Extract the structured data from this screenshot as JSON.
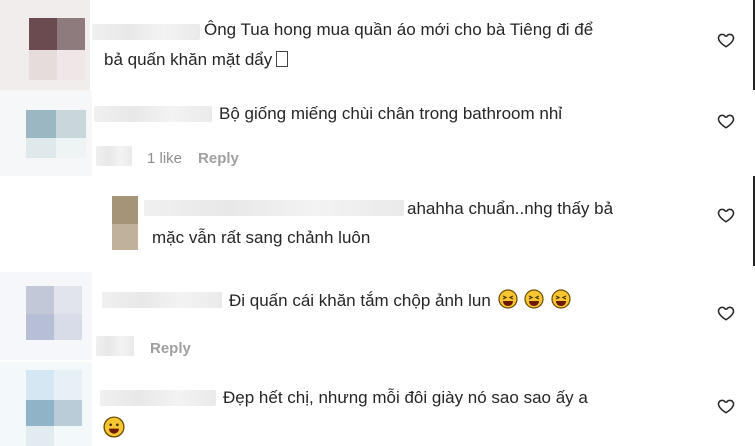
{
  "comments": [
    {
      "text_line1": "Ông Tua hong mua quần áo mới cho bà Tiêng đi để",
      "text_line2": "bả quấn khăn mặt dẩy"
    },
    {
      "text_line1": "Bộ giống miếng chùi chân trong bathroom nhỉ",
      "likes": "1 like",
      "reply": "Reply"
    },
    {
      "text_line1": "ahahha chuẩn..nhg thấy bả",
      "text_line2": "mặc vẫn rất sang chảnh luôn"
    },
    {
      "text_line1": "Đi quấn cái khăn tắm chộp ảnh lun",
      "reply": "Reply"
    },
    {
      "text_line1": "Đẹp hết chị, nhưng mỗi đôi giày nó sao sao ấy a"
    }
  ],
  "icons": {
    "like": "heart-outline-icon",
    "emoji_laugh": "laughing-face-emoji",
    "emoji_smile": "smiling-face-emoji"
  }
}
